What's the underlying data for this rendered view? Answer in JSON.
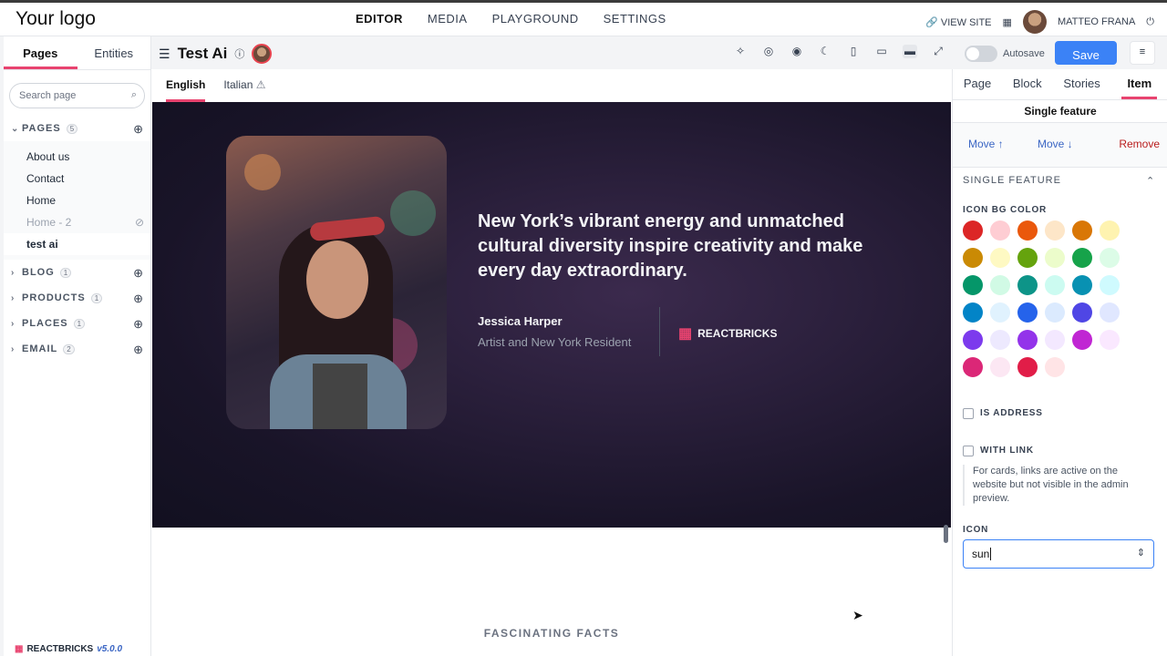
{
  "app": {
    "logo": "Your logo",
    "nav": [
      "EDITOR",
      "MEDIA",
      "PLAYGROUND",
      "SETTINGS"
    ],
    "view_site": "VIEW SITE",
    "user": "MATTEO FRANA"
  },
  "sidebar": {
    "tabs": [
      "Pages",
      "Entities"
    ],
    "search_placeholder": "Search page",
    "groups": [
      {
        "label": "PAGES",
        "count": "5"
      },
      {
        "label": "BLOG",
        "count": "1"
      },
      {
        "label": "PRODUCTS",
        "count": "1"
      },
      {
        "label": "PLACES",
        "count": "1"
      },
      {
        "label": "EMAIL",
        "count": "2"
      }
    ],
    "pages": [
      "About us",
      "Contact",
      "Home",
      "Home - 2",
      "test ai"
    ],
    "brand": "REACTBRICKS",
    "version": "v5.0.0"
  },
  "editor": {
    "page_title": "Test Ai",
    "autosave_label": "Autosave",
    "save_label": "Save",
    "languages": [
      "English",
      "Italian"
    ]
  },
  "hero": {
    "quote": "New York’s vibrant energy and unmatched cultural diversity inspire creativity and make every day extraordinary.",
    "author_name": "Jessica Harper",
    "author_role": "Artist and New York Resident",
    "company": "REACTBRICKS"
  },
  "below": {
    "facts_heading": "FASCINATING FACTS"
  },
  "panel": {
    "tabs": [
      "Page",
      "Block",
      "Stories",
      "Item"
    ],
    "title": "Single feature",
    "move_up": "Move ↑",
    "move_down": "Move ↓",
    "remove": "Remove",
    "section": "SINGLE FEATURE",
    "icon_bg_label": "ICON BG COLOR",
    "colors": [
      "#dc2626",
      "#fecdd3",
      "#ea580c",
      "#fde6c8",
      "#d97706",
      "#fef3b0",
      "#ca8a04",
      "#fef9c3",
      "#65a30d",
      "#ecfccb",
      "#16a34a",
      "#dcfce7",
      "#059669",
      "#d1fae5",
      "#0d9488",
      "#ccfbf1",
      "#0891b2",
      "#cffafe",
      "#0284c7",
      "#e0f2fe",
      "#2563eb",
      "#dbeafe",
      "#4f46e5",
      "#e0e7ff",
      "#7c3aed",
      "#ede9fe",
      "#9333ea",
      "#f3e8ff",
      "#c026d3",
      "#fae8ff",
      "#db2777",
      "#fce7f3",
      "#e11d48",
      "#ffe4e6"
    ],
    "is_address_label": "IS ADDRESS",
    "with_link_label": "WITH LINK",
    "help_text": "For cards, links are active on the website but not visible in the admin preview.",
    "icon_label": "ICON",
    "icon_value": "sun"
  }
}
